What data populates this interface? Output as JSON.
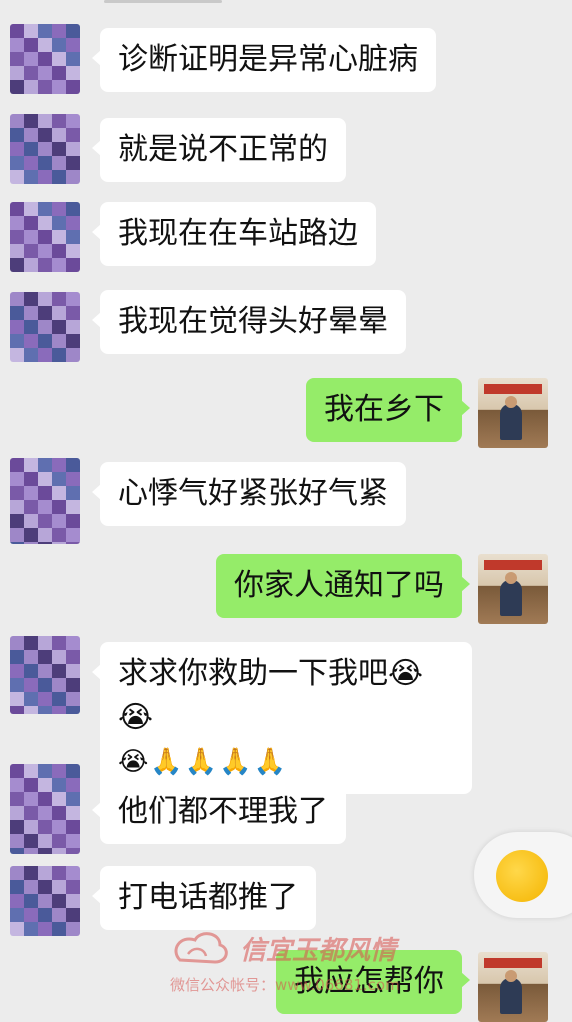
{
  "colors": {
    "background": "#ececec",
    "incoming_bubble": "#ffffff",
    "outgoing_bubble": "#95ec69",
    "watermark": "#d9534f"
  },
  "messages": [
    {
      "side": "in",
      "text": "诊断证明是异常心脏病"
    },
    {
      "side": "in",
      "text": "就是说不正常的"
    },
    {
      "side": "in",
      "text": "我现在在车站路边"
    },
    {
      "side": "in",
      "text": "我现在觉得头好晕晕"
    },
    {
      "side": "out",
      "text": "我在乡下"
    },
    {
      "side": "in",
      "text": "心悸气好紧张好气紧"
    },
    {
      "side": "out",
      "text": "你家人通知了吗"
    },
    {
      "side": "in",
      "text": "求求你救助一下我吧😭😭",
      "text2": "😭🙏🙏🙏🙏"
    },
    {
      "side": "in",
      "text": "他们都不理我了"
    },
    {
      "side": "in",
      "text": "打电话都推了"
    },
    {
      "side": "out",
      "text": "我应怎帮你"
    }
  ],
  "avatars": {
    "incoming": "pixelated-avatar",
    "outgoing": "photo-avatar"
  },
  "floating_ball": {
    "icon": "float-window-icon"
  },
  "watermark": {
    "title": "信宜玉都风情",
    "subtitle": "微信公众帐号：www.06681.com"
  }
}
